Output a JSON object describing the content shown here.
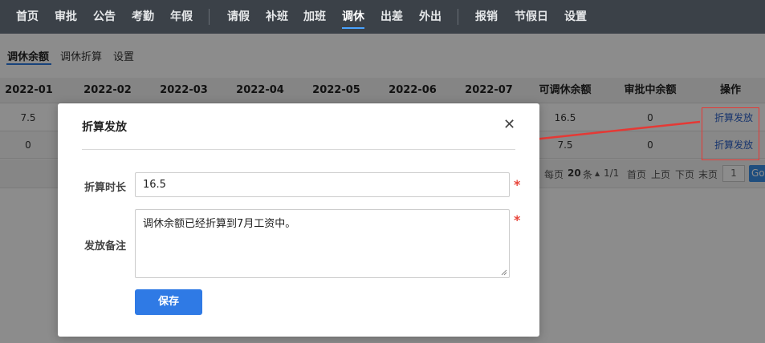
{
  "topnav": {
    "items": [
      "首页",
      "审批",
      "公告",
      "考勤",
      "年假",
      "请假",
      "补班",
      "加班",
      "调休",
      "出差",
      "外出",
      "报销",
      "节假日",
      "设置"
    ],
    "active": "调休"
  },
  "subtabs": {
    "items": [
      "调休余额",
      "调休折算",
      "设置"
    ],
    "active": "调休余额"
  },
  "table": {
    "headers": [
      "2022-01",
      "2022-02",
      "2022-03",
      "2022-04",
      "2022-05",
      "2022-06",
      "2022-07",
      "可调休余额",
      "审批中余额",
      "操作"
    ],
    "rows": [
      {
        "first": "7.5",
        "balance": "16.5",
        "pending": "0",
        "action": "折算发放"
      },
      {
        "first": "0",
        "balance": "7.5",
        "pending": "0",
        "action": "折算发放"
      }
    ]
  },
  "pager": {
    "per_page_prefix": "每页",
    "per_page": "20",
    "per_page_suffix": "条",
    "pages": "1/1",
    "first": "首页",
    "prev": "上页",
    "next": "下页",
    "last": "末页",
    "page_value": "1",
    "go": "Go"
  },
  "modal": {
    "title": "折算发放",
    "duration_label": "折算时长",
    "duration_value": "16.5",
    "note_label": "发放备注",
    "note_value": "调休余额已经折算到7月工资中。",
    "save": "保存",
    "required_mark": "*",
    "close_glyph": "✕"
  },
  "colors": {
    "nav_bg": "#3b4148",
    "accent": "#2f7ae5",
    "link": "#2d62c8",
    "annotation": "#e53935",
    "required": "#e8443a"
  }
}
